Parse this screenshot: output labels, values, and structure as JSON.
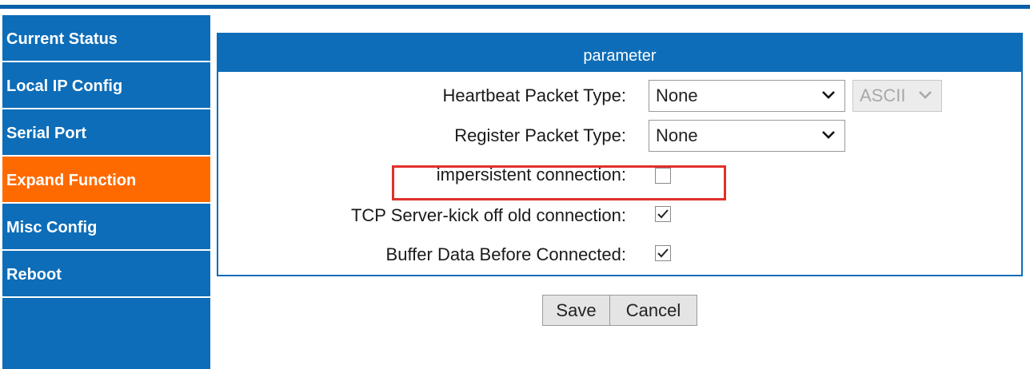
{
  "sidebar": {
    "items": [
      {
        "label": "Current Status"
      },
      {
        "label": "Local IP Config"
      },
      {
        "label": "Serial Port"
      },
      {
        "label": "Expand Function"
      },
      {
        "label": "Misc Config"
      },
      {
        "label": "Reboot"
      }
    ],
    "active_item": "Expand Function",
    "bg_color": "#0d6db8",
    "active_color": "#ff6a00"
  },
  "panel": {
    "title": "parameter",
    "fields": {
      "heartbeat": {
        "label": "Heartbeat Packet Type:",
        "value": "None",
        "format": "ASCII",
        "format_disabled": true
      },
      "register": {
        "label": "Register Packet Type:",
        "value": "None"
      },
      "impersistent": {
        "label": "impersistent connection:",
        "checked": false
      },
      "kick_old": {
        "label": "TCP Server-kick off old connection:",
        "checked": true
      },
      "buffer": {
        "label": "Buffer Data Before Connected:",
        "checked": true
      }
    }
  },
  "buttons": {
    "save": "Save",
    "cancel": "Cancel"
  },
  "highlight_color": "#e0302b"
}
